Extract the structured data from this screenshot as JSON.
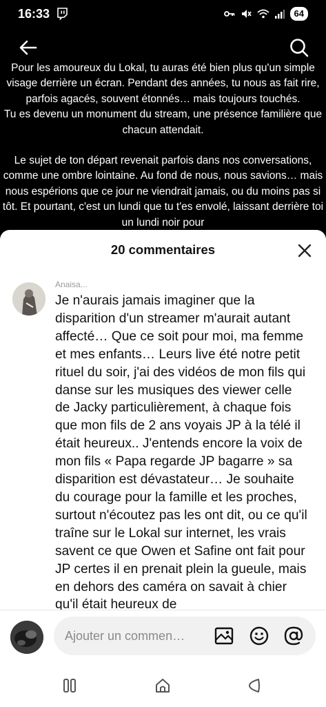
{
  "status": {
    "time": "16:33",
    "battery": "64",
    "icons": [
      "twitch-icon",
      "key-icon",
      "mute-icon",
      "wifi-icon",
      "signal-icon"
    ]
  },
  "header": {
    "icons": [
      "back-arrow-icon",
      "search-icon"
    ]
  },
  "description": {
    "paragraphs": [
      "Pour les amoureux du Lokal, tu auras été bien plus qu'un simple visage derrière un écran. Pendant des années, tu nous as fait rire, parfois agacés, souvent étonnés… mais toujours touchés.",
      "Tu es devenu un monument du stream, une présence familière que chacun attendait.",
      "Le sujet de ton départ revenait parfois dans nos conversations, comme une ombre lointaine. Au fond de nous, nous savions… mais nous espérions que ce jour ne viendrait jamais, ou du moins pas si tôt. Et pourtant, c'est un lundi que tu t'es envolé, laissant derrière toi un lundi noir pour"
    ]
  },
  "comments_sheet": {
    "title": "20 commentaires",
    "comment": {
      "username": "Anaisa...",
      "text": "Je n'aurais jamais imaginer que la disparition d'un streamer m'aurait autant affecté… Que ce soit pour moi, ma femme et mes enfants… Leurs live été notre petit rituel du soir, j'ai des vidéos de mon fils qui danse sur les musiques des viewer celle de Jacky particulièrement, à chaque fois que mon fils de 2 ans voyais JP à la télé il était heureux.. J'entends encore la voix de mon fils « Papa regarde JP bagarre » sa disparition est dévastateur… Je souhaite du courage pour la famille et les proches, surtout n'écoutez pas les ont dit, ou ce qu'il traîne sur le Lokal sur internet, les vrais savent ce que Owen et Safine ont fait pour JP certes il en prenait plein la gueule, mais en dehors des caméra on savait à chier qu'il était heureux de"
    },
    "composer": {
      "placeholder": "Ajouter un commen…",
      "icons": [
        "image-icon",
        "emoji-icon",
        "mention-icon"
      ]
    }
  },
  "navbar": {
    "icons": [
      "recent-apps-icon",
      "home-icon",
      "back-icon"
    ]
  },
  "colors": {
    "background": "#000000",
    "sheet": "#ffffff",
    "composer_bg": "#f1f1f2"
  }
}
